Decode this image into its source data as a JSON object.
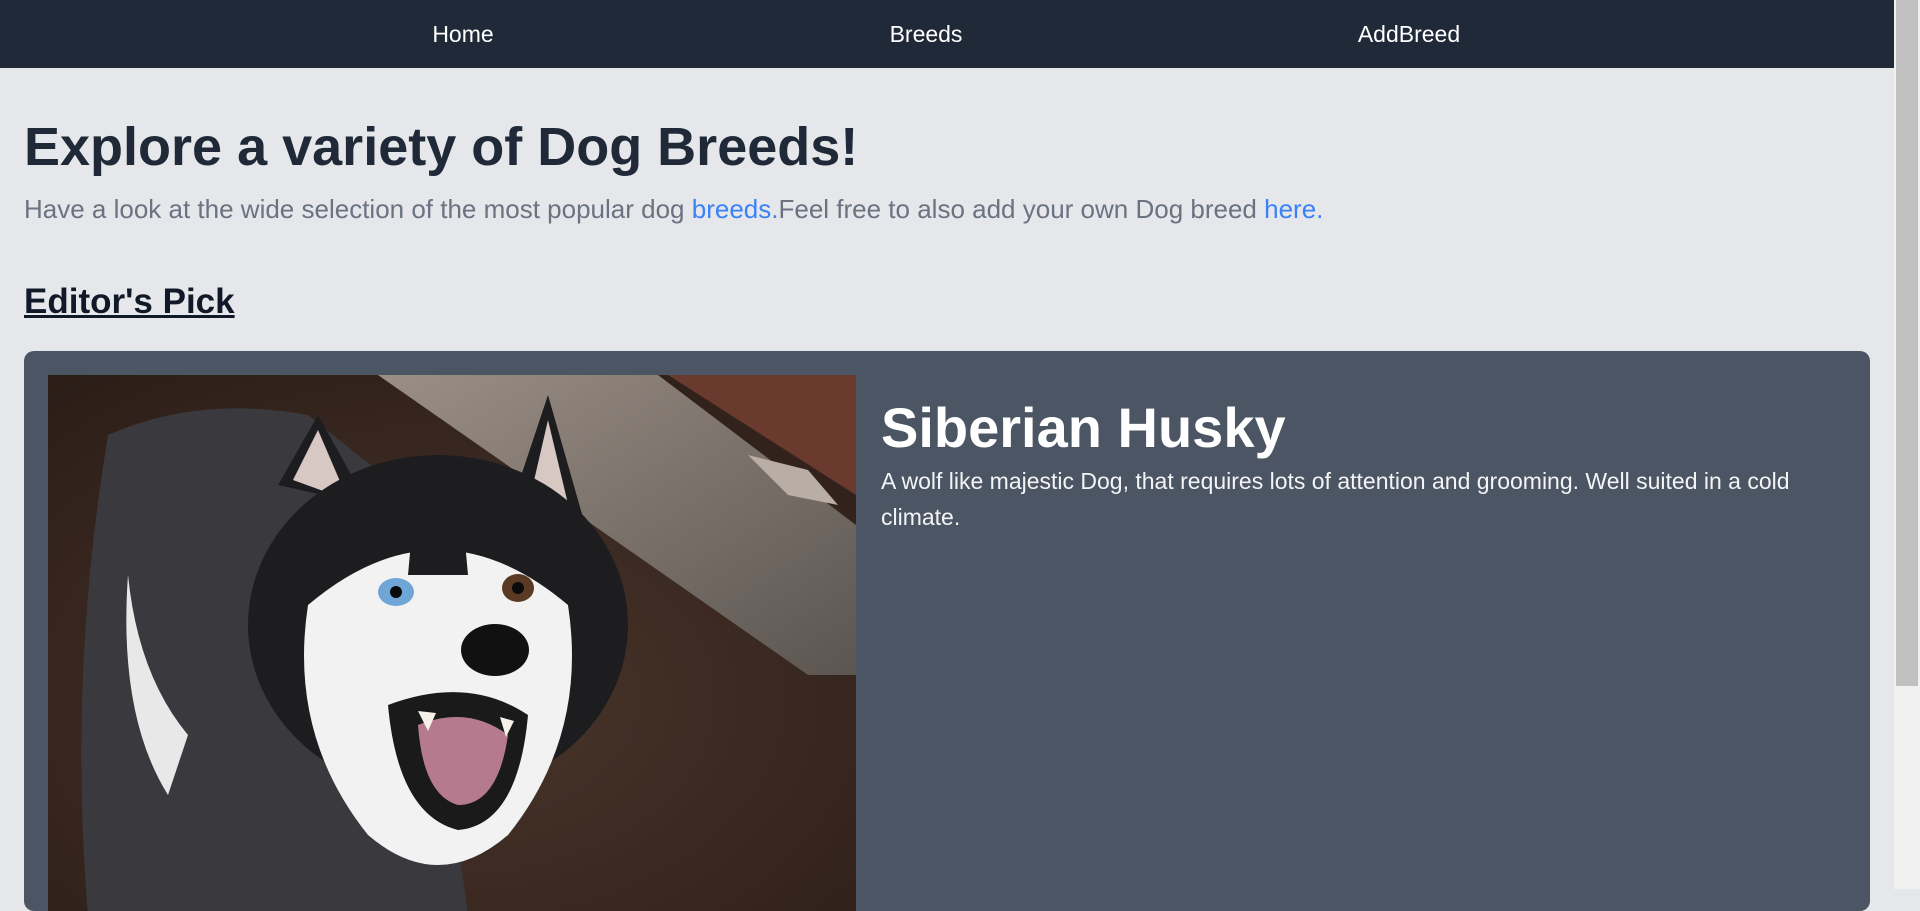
{
  "nav": {
    "items": [
      {
        "label": "Home"
      },
      {
        "label": "Breeds"
      },
      {
        "label": "AddBreed"
      }
    ]
  },
  "hero": {
    "title": "Explore a variety of Dog Breeds!",
    "subtitle_part1": "Have a look at the wide selection of the most popular dog ",
    "breeds_link": "breeds.",
    "subtitle_part2": "Feel free to also add your own Dog breed ",
    "here_link": "here."
  },
  "editors_pick": {
    "heading": "Editor's Pick",
    "breed_name": "Siberian Husky",
    "description": "A wolf like majestic Dog, that requires lots of attention and grooming. Well suited in a cold climate."
  },
  "colors": {
    "navbar": "#1f2937",
    "page_bg": "#e5e7eb",
    "card_bg": "#4b5563",
    "link": "#3b82f6"
  },
  "icons": {
    "dog_photo": "husky-photo"
  }
}
